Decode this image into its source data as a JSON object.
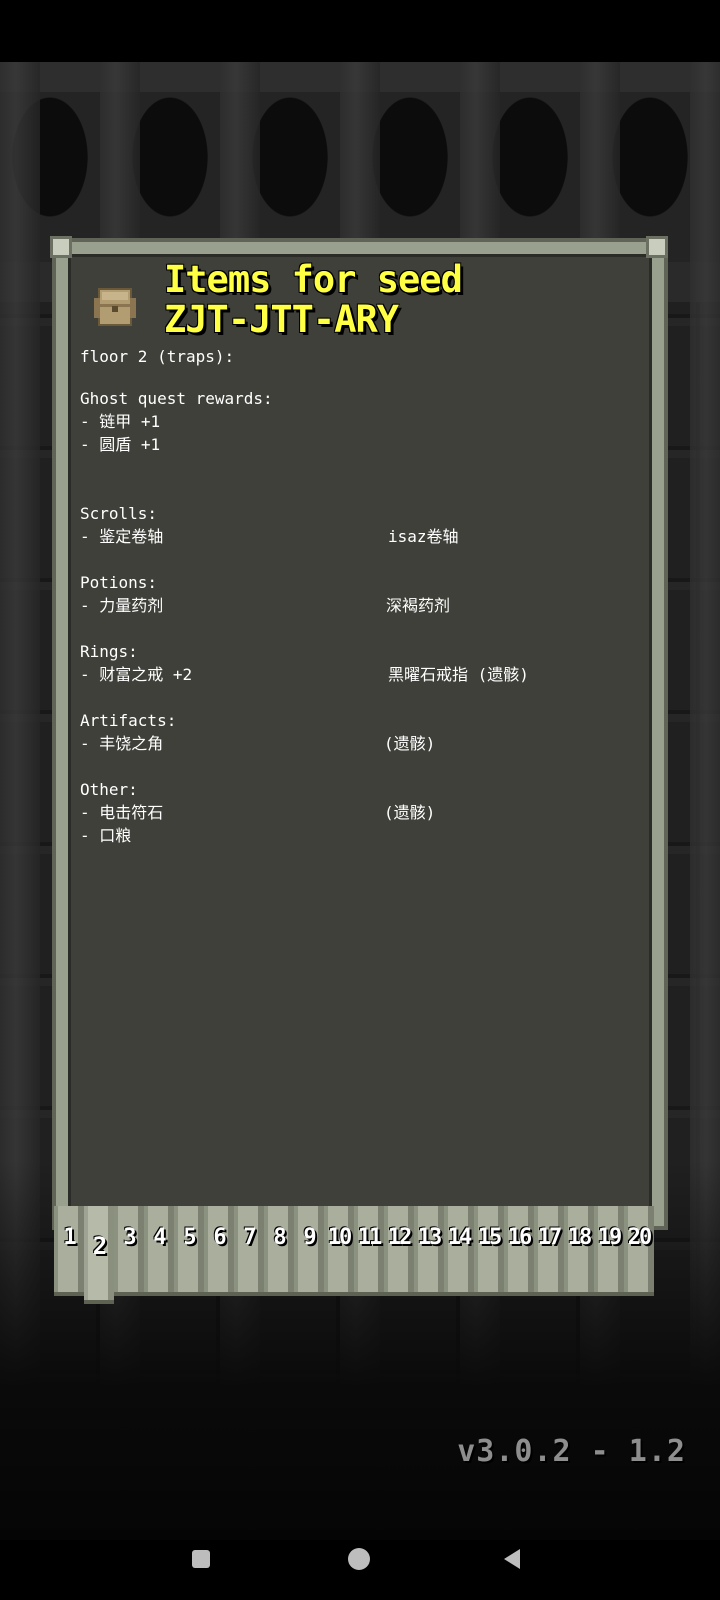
{
  "title_line1": "Items for seed",
  "title_line2": "ZJT-JTT-ARY",
  "floor_heading": "floor 2 (traps):",
  "ghost": {
    "heading": "Ghost quest rewards:",
    "items": [
      "- 链甲 +1",
      "- 圆盾 +1"
    ]
  },
  "scrolls": {
    "heading": "Scrolls:",
    "item": "- 鉴定卷轴",
    "detail": "isaz卷轴"
  },
  "potions": {
    "heading": "Potions:",
    "item": "- 力量药剂",
    "detail": "深褐药剂"
  },
  "rings": {
    "heading": "Rings:",
    "item": "- 财富之戒 +2",
    "detail": "黑曜石戒指 (遗骸)"
  },
  "artifacts": {
    "heading": "Artifacts:",
    "item": "- 丰饶之角",
    "detail": "(遗骸)"
  },
  "other": {
    "heading": "Other:",
    "items": [
      "- 电击符石",
      "- 口粮"
    ],
    "detail": "(遗骸)"
  },
  "tabs": [
    "1",
    "2",
    "3",
    "4",
    "5",
    "6",
    "7",
    "8",
    "9",
    "10",
    "11",
    "12",
    "13",
    "14",
    "15",
    "16",
    "17",
    "18",
    "19",
    "20"
  ],
  "active_tab": "2",
  "version": "v3.0.2 - 1.2",
  "colors": {
    "title": "#ffff44",
    "panel": "#3f403a",
    "frame": "#9aa08e"
  }
}
